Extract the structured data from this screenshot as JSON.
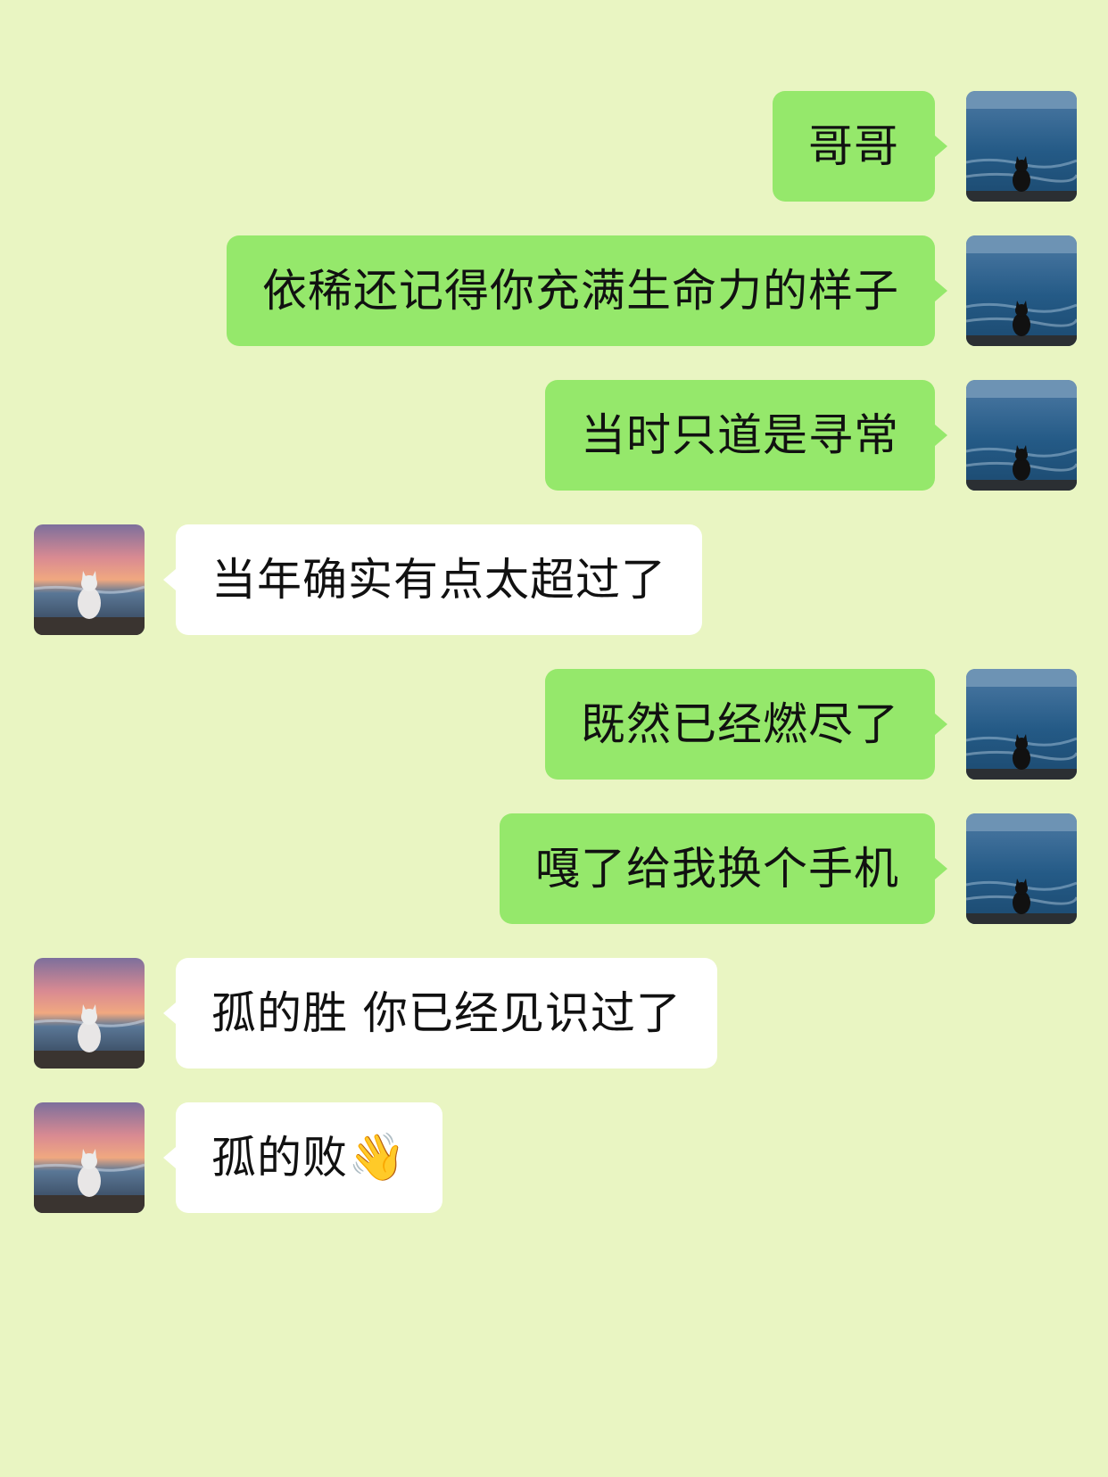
{
  "chat": {
    "messages": [
      {
        "direction": "out",
        "text": "哥哥",
        "avatar": "black-cat-ocean-avatar"
      },
      {
        "direction": "out",
        "text": "依稀还记得你充满生命力的样子",
        "avatar": "black-cat-ocean-avatar"
      },
      {
        "direction": "out",
        "text": "当时只道是寻常",
        "avatar": "black-cat-ocean-avatar"
      },
      {
        "direction": "in",
        "text": "当年确实有点太超过了",
        "avatar": "white-cat-sunset-avatar"
      },
      {
        "direction": "out",
        "text": "既然已经燃尽了",
        "avatar": "black-cat-ocean-avatar"
      },
      {
        "direction": "out",
        "text": "嘎了给我换个手机",
        "avatar": "black-cat-ocean-avatar"
      },
      {
        "direction": "in",
        "text": "孤的胜 你已经见识过了",
        "avatar": "white-cat-sunset-avatar"
      },
      {
        "direction": "in",
        "text": "孤的败",
        "emoji": "👋",
        "avatar": "white-cat-sunset-avatar"
      }
    ]
  },
  "colors": {
    "background": "#e9f5c2",
    "outgoing_bubble": "#95e86b",
    "incoming_bubble": "#ffffff"
  }
}
